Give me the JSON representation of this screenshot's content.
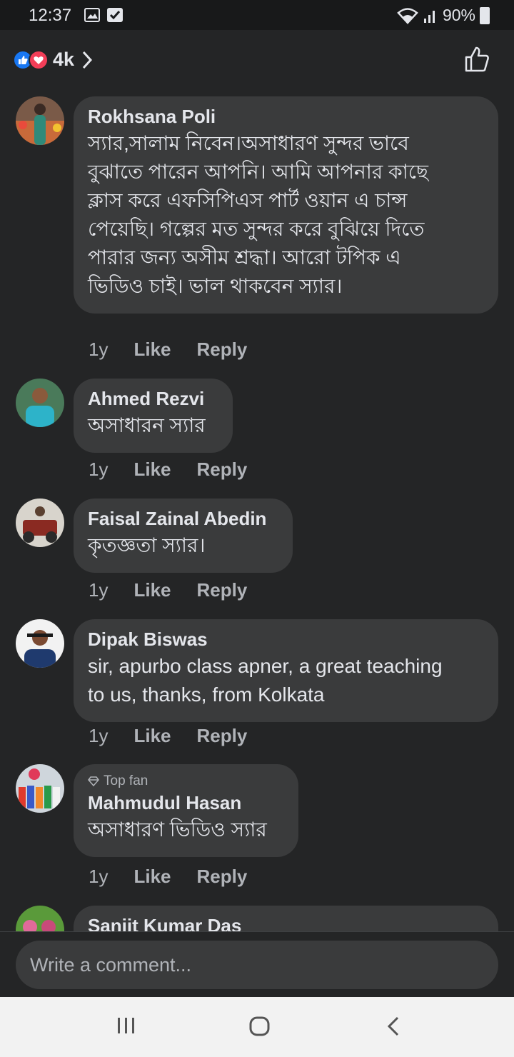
{
  "status_bar": {
    "time": "12:37",
    "battery": "90%"
  },
  "header": {
    "reaction_count": "4k"
  },
  "comments": [
    {
      "name": "Rokhsana Poli",
      "lines": [
        "স্যার,সালাম নিবেন।অসাধারণ সুন্দর ভাবে",
        "বুঝাতে পারেন আপনি। আমি আপনার কাছে",
        "ক্লাস করে এফসিপিএস পার্ট ওয়ান এ চান্স",
        "পেয়েছি।  গল্পের মত সুন্দর করে বুঝিয়ে দিতে",
        "পারার জন্য অসীম শ্রদ্ধা। আরো টপিক এ",
        "ভিডিও চাই। ভাল থাকবেন স্যার।"
      ],
      "time": "1y",
      "like": "Like",
      "reply": "Reply"
    },
    {
      "name": "Ahmed Rezvi",
      "lines": [
        "অসাধারন স্যার"
      ],
      "time": "1y",
      "like": "Like",
      "reply": "Reply"
    },
    {
      "name": "Faisal Zainal Abedin",
      "lines": [
        "কৃতজ্ঞতা স্যার।"
      ],
      "time": "1y",
      "like": "Like",
      "reply": "Reply"
    },
    {
      "name": "Dipak Biswas",
      "lines": [
        "sir, apurbo class apner, a great teaching",
        "to us, thanks, from Kolkata"
      ],
      "time": "1y",
      "like": "Like",
      "reply": "Reply"
    },
    {
      "badge": "Top fan",
      "name": "Mahmudul Hasan",
      "lines": [
        "অসাধারণ ভিডিও স্যার"
      ],
      "time": "1y",
      "like": "Like",
      "reply": "Reply"
    },
    {
      "name": "Sanjit Kumar Das"
    }
  ],
  "composer": {
    "placeholder": "Write a comment..."
  },
  "colors": {
    "background": "#242526",
    "bubble": "#3a3b3c",
    "like_blue": "#1877f2",
    "love_red": "#f33e58"
  },
  "icons": [
    "image-icon",
    "checkbox-icon",
    "wifi-icon",
    "signal-icon",
    "battery-icon",
    "like-reaction-icon",
    "love-reaction-icon",
    "chevron-right-icon",
    "thumbs-up-icon",
    "diamond-icon",
    "recent-apps-icon",
    "home-icon",
    "back-icon"
  ]
}
